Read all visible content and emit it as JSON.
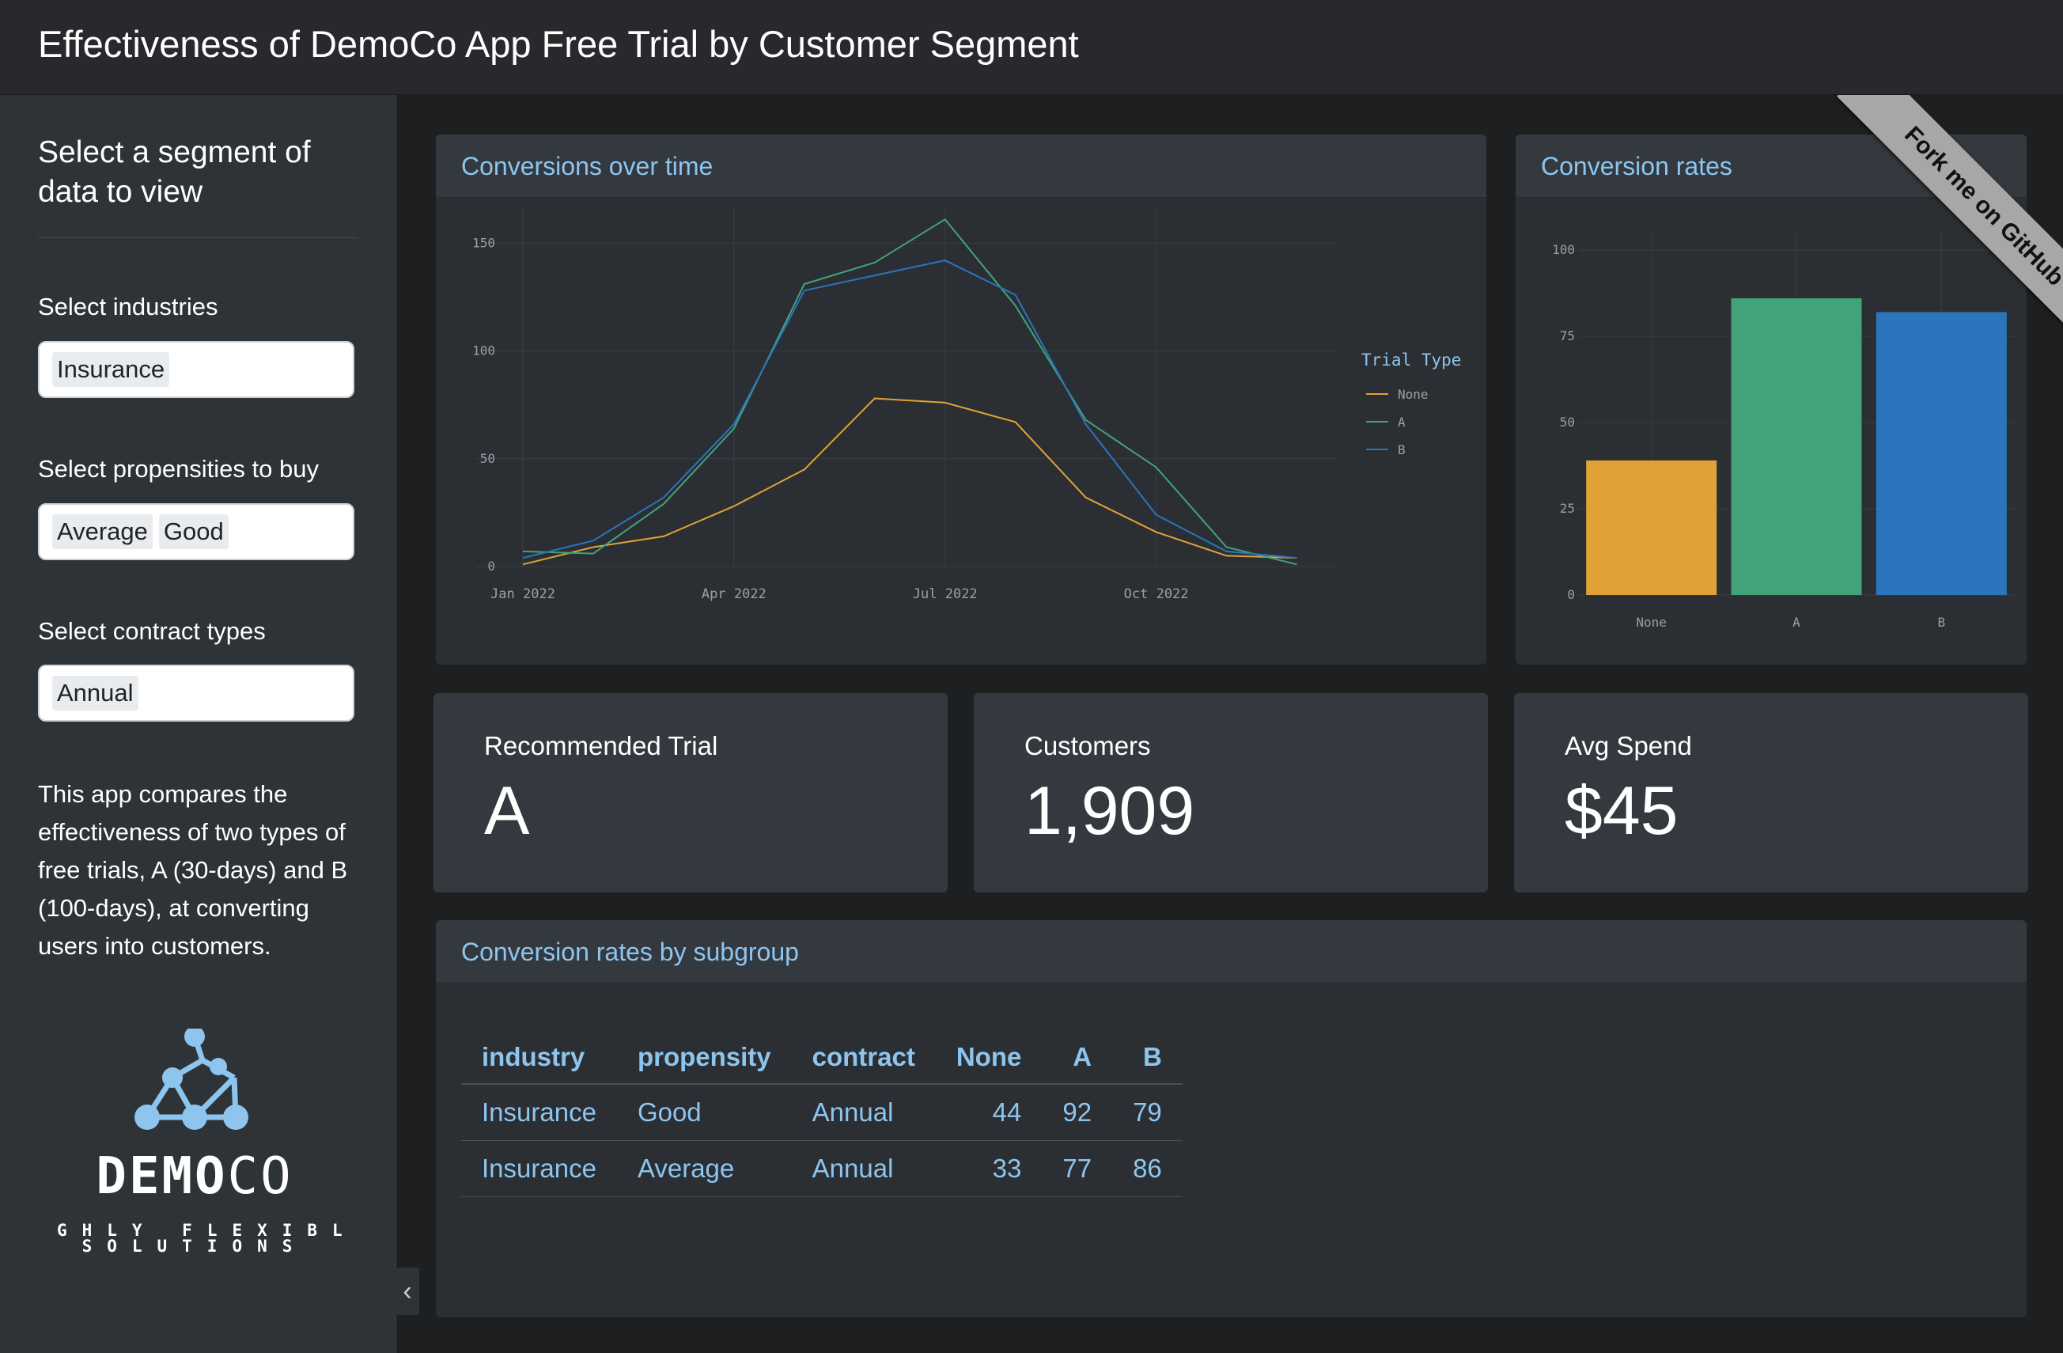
{
  "header": {
    "title": "Effectiveness of DemoCo App Free Trial by Customer Segment"
  },
  "sidebar": {
    "title": "Select a segment of data to view",
    "industries_label": "Select industries",
    "industries": [
      "Insurance"
    ],
    "propensities_label": "Select propensities to buy",
    "propensities": [
      "Average",
      "Good"
    ],
    "contracts_label": "Select contract types",
    "contracts": [
      "Annual"
    ],
    "description": "This app compares the effectiveness of two types of free trials, A (30-days) and B (100-days), at converting users into customers.",
    "logo": {
      "name": "DEMOCO",
      "name_bold": "DEMO",
      "name_light": "CO",
      "tagline_1": "HIGHLY FLEXIBLE",
      "tagline_2": "SOLUTIONS"
    },
    "collapse_icon": "chevron-left-icon"
  },
  "ribbon": {
    "text": "Fork me on GitHub"
  },
  "cards": {
    "conversions_over_time": "Conversions over time",
    "conversion_rates": "Conversion rates",
    "subgroup": "Conversion rates by subgroup"
  },
  "value_boxes": [
    {
      "title": "Recommended Trial",
      "value": "A"
    },
    {
      "title": "Customers",
      "value": "1,909"
    },
    {
      "title": "Avg Spend",
      "value": "$45"
    }
  ],
  "table": {
    "columns": [
      "industry",
      "propensity",
      "contract",
      "None",
      "A",
      "B"
    ],
    "rows": [
      [
        "Insurance",
        "Good",
        "Annual",
        "44",
        "92",
        "79"
      ],
      [
        "Insurance",
        "Average",
        "Annual",
        "33",
        "77",
        "86"
      ]
    ]
  },
  "colors": {
    "none": "#e0a237",
    "a": "#42a379",
    "b": "#2b75bd",
    "accent": "#8ec5ef"
  },
  "chart_data": [
    {
      "type": "line",
      "x": [
        "Jan 2022",
        "Feb 2022",
        "Mar 2022",
        "Apr 2022",
        "May 2022",
        "Jun 2022",
        "Jul 2022",
        "Aug 2022",
        "Sep 2022",
        "Oct 2022",
        "Nov 2022",
        "Dec 2022"
      ],
      "xticks": [
        "Jan 2022",
        "Apr 2022",
        "Jul 2022",
        "Oct 2022"
      ],
      "yticks": [
        0,
        50,
        100,
        150
      ],
      "ylim": [
        0,
        160
      ],
      "legend_title": "Trial Type",
      "legend_position": "right",
      "grid": true,
      "series": [
        {
          "name": "None",
          "values": [
            1,
            9,
            14,
            28,
            45,
            78,
            76,
            67,
            32,
            16,
            5,
            4
          ]
        },
        {
          "name": "A",
          "values": [
            7,
            6,
            29,
            64,
            131,
            141,
            161,
            121,
            68,
            46,
            9,
            1
          ]
        },
        {
          "name": "B",
          "values": [
            4,
            12,
            32,
            66,
            128,
            135,
            142,
            126,
            66,
            24,
            7,
            4
          ]
        }
      ]
    },
    {
      "type": "bar",
      "categories": [
        "None",
        "A",
        "B"
      ],
      "values": [
        39,
        86,
        82
      ],
      "yticks": [
        0,
        25,
        50,
        75,
        100
      ],
      "ylim": [
        0,
        100
      ]
    }
  ]
}
